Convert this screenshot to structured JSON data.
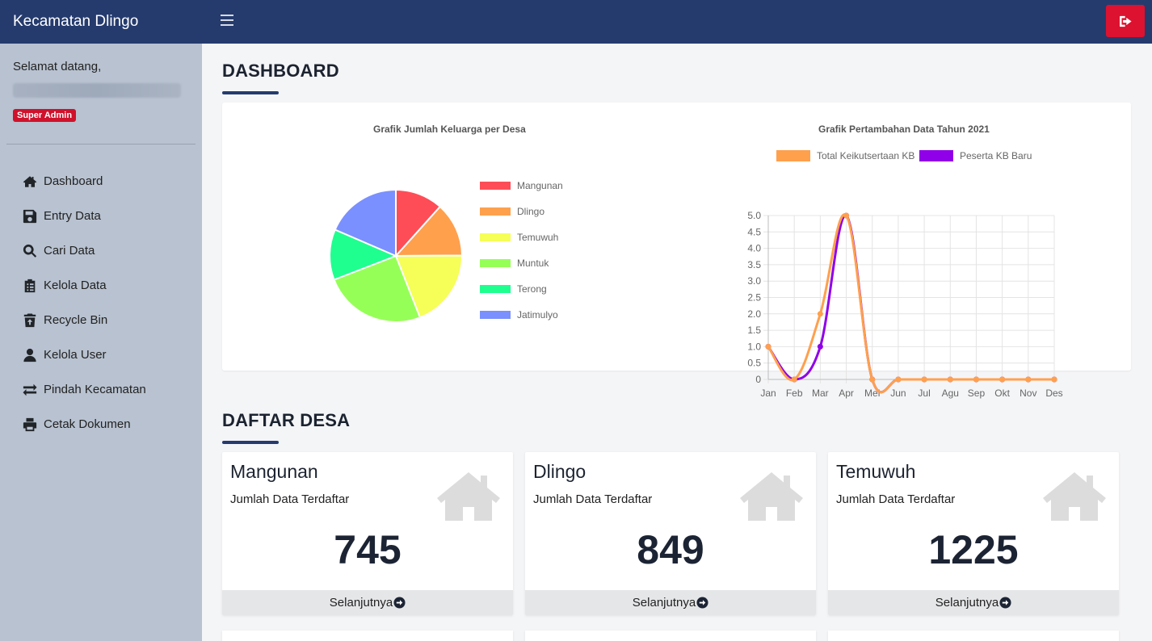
{
  "brand": "Kecamatan Dlingo",
  "sidebar": {
    "welcome": "Selamat datang,",
    "role": "Super Admin",
    "items": [
      {
        "label": "Dashboard",
        "icon": "home-icon"
      },
      {
        "label": "Entry Data",
        "icon": "save-icon"
      },
      {
        "label": "Cari Data",
        "icon": "search-icon"
      },
      {
        "label": "Kelola Data",
        "icon": "clipboard-icon"
      },
      {
        "label": "Recycle Bin",
        "icon": "trash-restore-icon"
      },
      {
        "label": "Kelola User",
        "icon": "user-icon"
      },
      {
        "label": "Pindah Kecamatan",
        "icon": "exchange-icon"
      },
      {
        "label": "Cetak Dokumen",
        "icon": "print-icon"
      }
    ]
  },
  "colors": {
    "navy": "#253b6e",
    "danger": "#dc1230",
    "sidebar_bg": "#b8c2d0"
  },
  "main": {
    "dashboard_title": "DASHBOARD",
    "villages_title": "DAFTAR DESA"
  },
  "chart_data": [
    {
      "type": "pie",
      "title": "Grafik Jumlah Keluarga per Desa",
      "labels": [
        "Mangunan",
        "Dlingo",
        "Temuwuh",
        "Muntuk",
        "Terong",
        "Jatimulyo"
      ],
      "values": [
        745,
        849,
        1225,
        1606,
        790,
        1185
      ],
      "colors": [
        "#ff4d57",
        "#ffa04d",
        "#f5ff57",
        "#96ff57",
        "#1fff8f",
        "#7a90ff"
      ],
      "legend": "right"
    },
    {
      "type": "line",
      "title": "Grafik Pertambahan Data Tahun 2021",
      "categories": [
        "Jan",
        "Feb",
        "Mar",
        "Apr",
        "Mei",
        "Jun",
        "Jul",
        "Agu",
        "Sep",
        "Okt",
        "Nov",
        "Des"
      ],
      "series": [
        {
          "name": "Total Keikutsertaan KB",
          "color": "#ffa04d",
          "values": [
            1,
            0,
            2,
            5,
            0,
            0,
            0,
            0,
            0,
            0,
            0,
            0
          ]
        },
        {
          "name": "Peserta KB Baru",
          "color": "#9000e8",
          "values": [
            1,
            0,
            1,
            5,
            0,
            0,
            0,
            0,
            0,
            0,
            0,
            0
          ]
        }
      ],
      "ylim": [
        0,
        5
      ],
      "yticks": [
        "5.0",
        "4.5",
        "4.0",
        "3.5",
        "3.0",
        "2.5",
        "2.0",
        "1.5",
        "1.0",
        "0.5",
        "0"
      ],
      "grid": true,
      "legend": "top"
    }
  ],
  "villages": [
    {
      "name": "Mangunan",
      "subtitle": "Jumlah Data Terdaftar",
      "count": "745",
      "link": "Selanjutnya"
    },
    {
      "name": "Dlingo",
      "subtitle": "Jumlah Data Terdaftar",
      "count": "849",
      "link": "Selanjutnya"
    },
    {
      "name": "Temuwuh",
      "subtitle": "Jumlah Data Terdaftar",
      "count": "1225",
      "link": "Selanjutnya"
    }
  ]
}
